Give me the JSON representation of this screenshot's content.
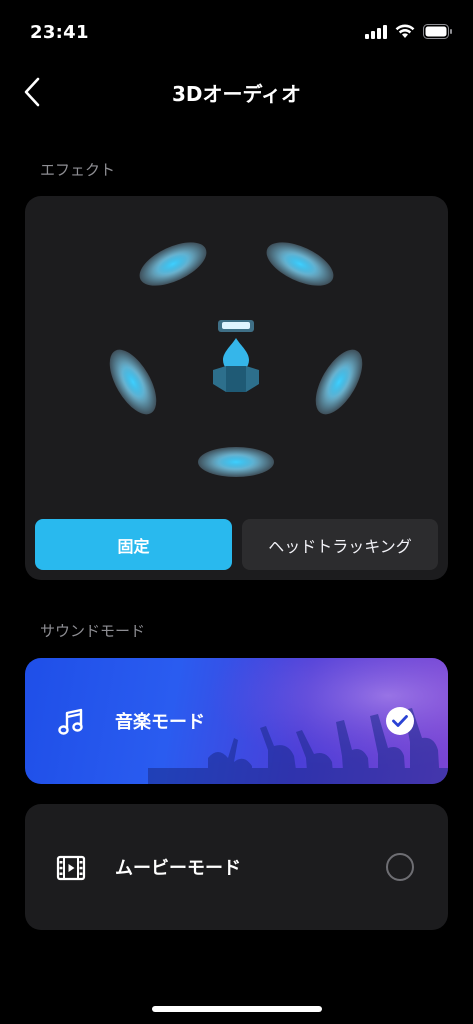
{
  "status_bar": {
    "time": "23:41"
  },
  "nav": {
    "title": "3Dオーディオ"
  },
  "effect": {
    "section_label": "エフェクト",
    "options": [
      {
        "label": "固定",
        "selected": true
      },
      {
        "label": "ヘッドトラッキング",
        "selected": false
      }
    ]
  },
  "sound_mode": {
    "section_label": "サウンドモード",
    "modes": [
      {
        "label": "音楽モード",
        "icon": "music-note-icon",
        "selected": true
      },
      {
        "label": "ムービーモード",
        "icon": "film-icon",
        "selected": false
      }
    ]
  },
  "colors": {
    "accent": "#29b9ee",
    "music_card_start": "#1f4fe8",
    "music_card_end": "#7a45d4"
  }
}
